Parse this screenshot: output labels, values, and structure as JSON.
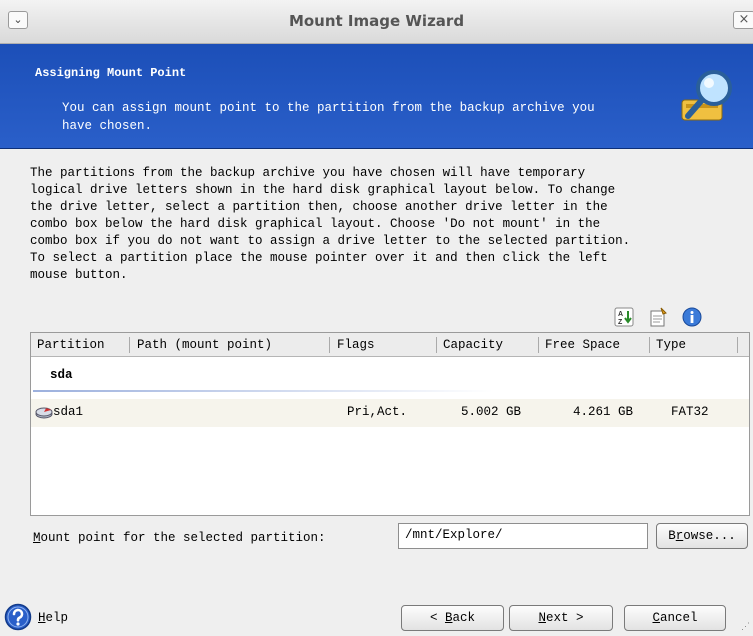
{
  "window": {
    "title": "Mount Image Wizard",
    "menu_glyph": "⌄",
    "close_glyph": "×"
  },
  "header": {
    "title": "Assigning Mount Point",
    "description": "You can assign mount point to the partition from the backup archive you have chosen.",
    "icon": "wizard-magnifier-icon"
  },
  "intro_text": "The partitions from the backup archive you have chosen will have temporary\nlogical drive letters shown in the hard disk graphical layout below. To change\nthe drive letter, select a partition then, choose another drive letter in the\ncombo box below the hard disk graphical layout. Choose 'Do not mount' in the\ncombo box if you do not want to assign a drive letter to the selected partition.\nTo select a partition place the mouse pointer over it and then click the left\nmouse button.",
  "toolbar": {
    "icons": [
      "sort-icon",
      "properties-icon",
      "info-icon"
    ]
  },
  "table": {
    "columns": [
      "Partition",
      "Path (mount point)",
      "Flags",
      "Capacity",
      "Free Space",
      "Type"
    ],
    "group": "sda",
    "rows": [
      {
        "partition": "sda1",
        "path": "",
        "flags": "Pri,Act.",
        "capacity": "5.002 GB",
        "free_space": "4.261 GB",
        "type": "FAT32",
        "icon": "partition-icon"
      }
    ]
  },
  "mount_point": {
    "label_mnemonic": "M",
    "label_rest": "ount point for the selected partition:",
    "value": "/mnt/Explore/",
    "browse_mnemonic": "r",
    "browse_before": "B",
    "browse_after": "owse..."
  },
  "footer": {
    "help_mnemonic": "H",
    "help_rest": "elp",
    "back_prefix": "< ",
    "back_mnemonic": "B",
    "back_rest": "ack",
    "next_mnemonic": "N",
    "next_rest": "ext >",
    "cancel_mnemonic": "C",
    "cancel_rest": "ancel"
  },
  "colors": {
    "header_bg": "#1c4fb8",
    "window_bg": "#efefef",
    "row_highlight": "#f6f4ec"
  }
}
